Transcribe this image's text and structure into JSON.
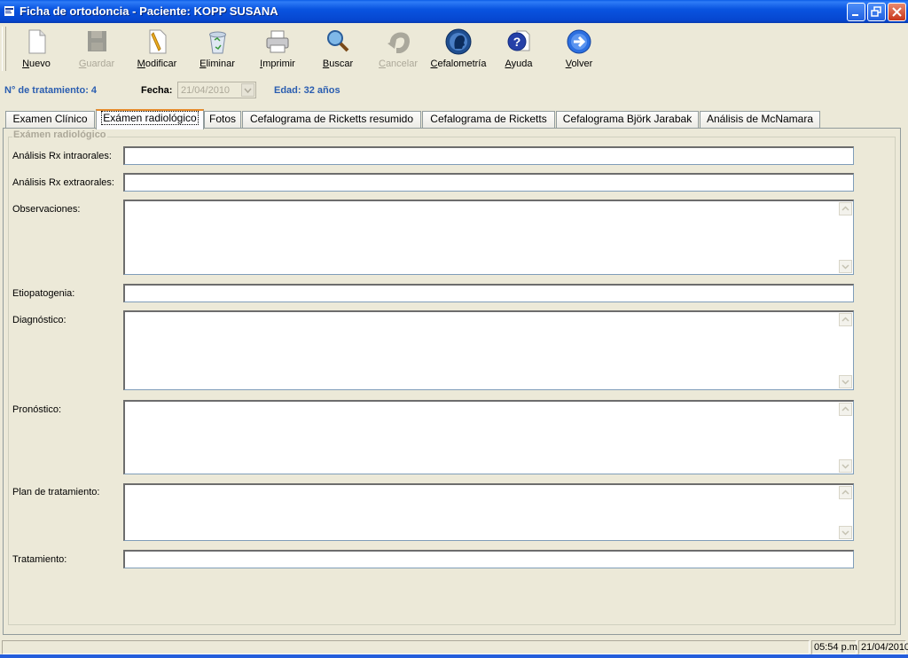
{
  "window": {
    "title": "Ficha de ortodoncia - Paciente: KOPP SUSANA",
    "icons": [
      "app-icon",
      "minimize-icon",
      "restore-icon",
      "close-icon"
    ]
  },
  "toolbar": {
    "nuevo": "Nuevo",
    "guardar": "Guardar",
    "modificar": "Modificar",
    "eliminar": "Eliminar",
    "imprimir": "Imprimir",
    "buscar": "Buscar",
    "cancelar": "Cancelar",
    "cefalometria": "Cefalometría",
    "ayuda": "Ayuda",
    "volver": "Volver"
  },
  "header": {
    "treatment_label": "N° de tratamiento: 4",
    "date_label": "Fecha:",
    "date_value": "21/04/2010",
    "age_label": "Edad: 32 años"
  },
  "tabs": [
    {
      "label": "Examen Clínico"
    },
    {
      "label": "Exámen radiológico"
    },
    {
      "label": "Fotos"
    },
    {
      "label": "Cefalograma de Ricketts resumido"
    },
    {
      "label": "Cefalograma de Ricketts"
    },
    {
      "label": "Cefalograma Björk Jarabak"
    },
    {
      "label": "Análisis de McNamara"
    }
  ],
  "active_tab": "Exámen radiológico",
  "form": {
    "group_title": "Exámen radiológico",
    "fields": [
      {
        "label": "Análisis Rx intraorales:",
        "value": ""
      },
      {
        "label": "Análisis Rx extraorales:",
        "value": ""
      },
      {
        "label": "Observaciones:",
        "value": ""
      },
      {
        "label": "Etiopatogenia:",
        "value": ""
      },
      {
        "label": "Diagnóstico:",
        "value": ""
      },
      {
        "label": "Pronóstico:",
        "value": ""
      },
      {
        "label": "Plan de tratamiento:",
        "value": ""
      },
      {
        "label": "Tratamiento:",
        "value": ""
      }
    ]
  },
  "status": {
    "time": "05:54 p.m.",
    "date": "21/04/2010"
  },
  "colors": {
    "titlebar": "#0954e0",
    "info_text": "#2a5db0",
    "active_tab_accent": "#e68b2c",
    "window_bg": "#ece9d8"
  }
}
